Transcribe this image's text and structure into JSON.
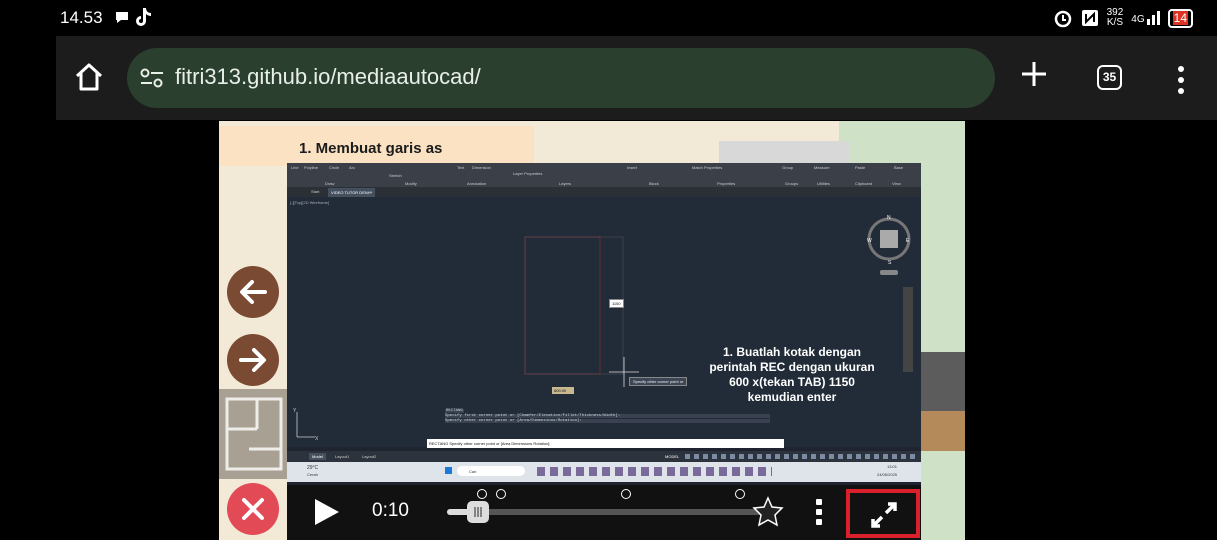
{
  "status_bar": {
    "time": "14.53",
    "speed_value": "392",
    "speed_unit": "K/S",
    "network": "4G",
    "battery": "14"
  },
  "browser": {
    "url": "fitri313.github.io/mediaautocad/",
    "tab_count": "35"
  },
  "page": {
    "header": "1. Membuat garis as",
    "video": {
      "instruction": "1. Buatlah kotak dengan perintah REC dengan ukuran 600 x(tekan TAB) 1150 kemudian enter",
      "current_time": "0:10",
      "progress": 0.06,
      "autocad": {
        "tab_start": "Start",
        "tab_file": "VIDEO TUTOR DENH*",
        "viewport_label": "[-][Top][2D Wireframe]",
        "ribbon_items": [
          "Line",
          "Polyline",
          "Circle",
          "Arc",
          "Stretch",
          "Text",
          "Dimension",
          "Layer Properties",
          "Insert",
          "Match Properties",
          "Group",
          "Measure",
          "Paste",
          "Base"
        ],
        "panel_labels": [
          "Draw",
          "Modify",
          "Annotation",
          "Layers",
          "Block",
          "Properties",
          "Groups",
          "Utilities",
          "Clipboard",
          "View"
        ],
        "cmd_history": [
          "RECTANG",
          "Specify first corner point or [Chamfer/Elevation/Fillet/Thickness/Width]:",
          "Specify other corner point or [Area/Dimensions/Rotation]:"
        ],
        "cmd_prompt": "RECTANG Specify other corner point or [Area Dimensions Rotation]:",
        "layout_tabs": [
          "Model",
          "Layout1",
          "Layout2"
        ],
        "status_mode": "MODEL",
        "tooltip": "Specify other corner point or",
        "dim_box": "1150",
        "dim_field": "600.00",
        "taskbar_weather": "29°C",
        "taskbar_weather_sub": "Cerah",
        "taskbar_search": "Cari",
        "taskbar_clock": "13:01",
        "taskbar_date": "24/06/2025"
      }
    }
  }
}
